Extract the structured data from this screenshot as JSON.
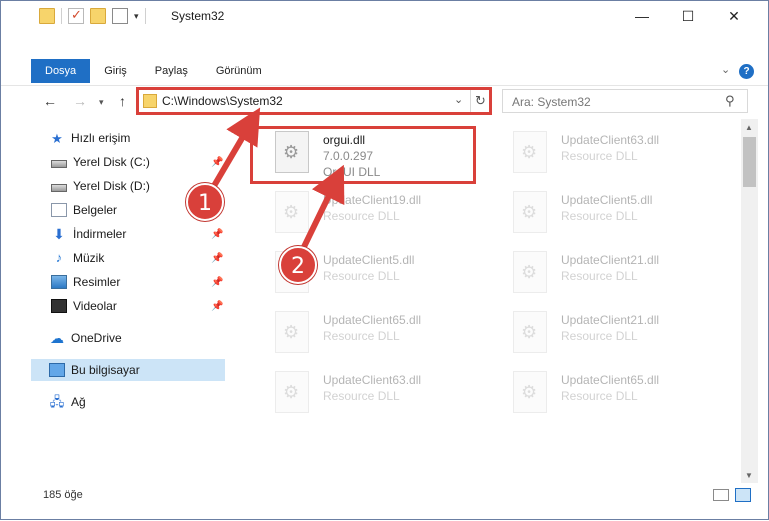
{
  "window": {
    "title": "System32",
    "controls": {
      "minimize": "—",
      "maximize": "☐",
      "close": "✕"
    }
  },
  "ribbon": {
    "tabs": [
      {
        "label": "Dosya",
        "active": true
      },
      {
        "label": "Giriş",
        "active": false
      },
      {
        "label": "Paylaş",
        "active": false
      },
      {
        "label": "Görünüm",
        "active": false
      }
    ],
    "help_label": "?"
  },
  "navigation": {
    "address": "C:\\Windows\\System32",
    "search_placeholder": "Ara: System32"
  },
  "sidebar": {
    "items": [
      {
        "label": "Hızlı erişim",
        "icon": "star-icon",
        "pinned": false
      },
      {
        "label": "Yerel Disk (C:)",
        "icon": "drive-icon",
        "pinned": true
      },
      {
        "label": "Yerel Disk (D:)",
        "icon": "drive-icon",
        "pinned": false
      },
      {
        "label": "Belgeler",
        "icon": "document-icon",
        "pinned": false
      },
      {
        "label": "İndirmeler",
        "icon": "download-icon",
        "pinned": true
      },
      {
        "label": "Müzik",
        "icon": "music-icon",
        "pinned": true
      },
      {
        "label": "Resimler",
        "icon": "pictures-icon",
        "pinned": true
      },
      {
        "label": "Videolar",
        "icon": "video-icon",
        "pinned": true
      },
      {
        "label": "OneDrive",
        "icon": "cloud-icon",
        "pinned": false
      },
      {
        "label": "Bu bilgisayar",
        "icon": "computer-icon",
        "pinned": false,
        "selected": true
      },
      {
        "label": "Ağ",
        "icon": "network-icon",
        "pinned": false
      }
    ]
  },
  "files": [
    {
      "name": "orgui.dll",
      "line2": "7.0.0.297",
      "line3": "OrgUI DLL",
      "highlighted": true
    },
    {
      "name": "UpdateClient63.dll",
      "line2": "Resource DLL"
    },
    {
      "name": "UpdateClient19.dll",
      "line2": "Resource DLL"
    },
    {
      "name": "UpdateClient5.dll",
      "line2": "Resource DLL"
    },
    {
      "name": "UpdateClient5.dll",
      "line2": "Resource DLL"
    },
    {
      "name": "UpdateClient21.dll",
      "line2": "Resource DLL"
    },
    {
      "name": "UpdateClient65.dll",
      "line2": "Resource DLL"
    },
    {
      "name": "UpdateClient21.dll",
      "line2": "Resource DLL"
    },
    {
      "name": "UpdateClient63.dll",
      "line2": "Resource DLL"
    },
    {
      "name": "UpdateClient65.dll",
      "line2": "Resource DLL"
    }
  ],
  "status": {
    "count": "185 öğe"
  },
  "callouts": [
    "1",
    "2"
  ],
  "colors": {
    "accent": "#1f6fc5",
    "highlight": "#d9403a",
    "selection": "#cce4f7"
  }
}
